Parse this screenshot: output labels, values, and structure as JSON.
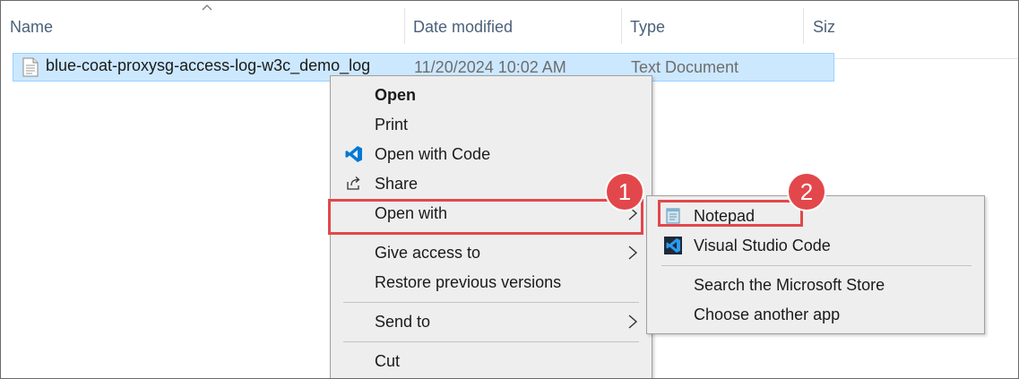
{
  "columns": {
    "name": "Name",
    "date_modified": "Date modified",
    "type": "Type",
    "size": "Size"
  },
  "file": {
    "name": "blue-coat-proxysg-access-log-w3c_demo_log",
    "date": "11/20/2024 10:02 AM",
    "type": "Text Document",
    "icon": "text-file-icon"
  },
  "context_menu": {
    "open": "Open",
    "print": "Print",
    "open_with_code": "Open with Code",
    "share": "Share",
    "open_with": "Open with",
    "give_access_to": "Give access to",
    "restore_previous_versions": "Restore previous versions",
    "send_to": "Send to",
    "cut": "Cut"
  },
  "submenu": {
    "notepad": "Notepad",
    "vscode": "Visual Studio Code",
    "search_store": "Search the Microsoft Store",
    "choose_app": "Choose another app"
  },
  "callouts": {
    "step1": "1",
    "step2": "2"
  },
  "colors": {
    "selection": "#cce8ff",
    "callout_red": "#e2474b",
    "vscode_blue": "#0078d4",
    "menu_bg": "#eeeeee"
  }
}
